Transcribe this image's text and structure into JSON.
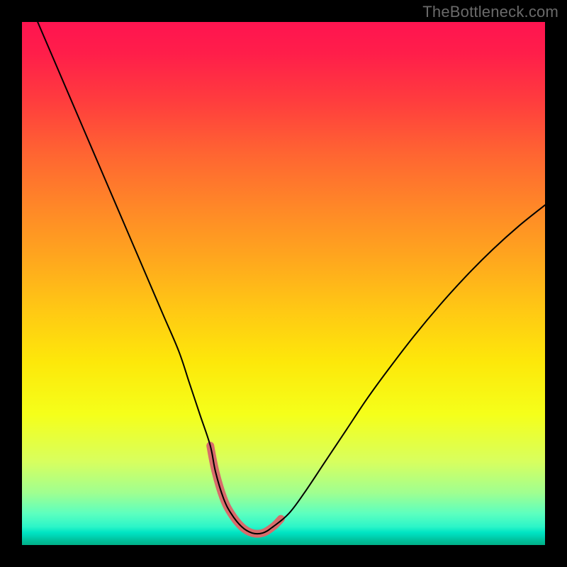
{
  "watermark": "TheBottleneck.com",
  "chart_data": {
    "type": "line",
    "title": "",
    "xlabel": "",
    "ylabel": "",
    "xlim": [
      0,
      100
    ],
    "ylim": [
      0,
      100
    ],
    "grid": false,
    "legend": false,
    "background_gradient": {
      "direction": "vertical",
      "stops": [
        {
          "pos": 0.0,
          "color": "#ff1450"
        },
        {
          "pos": 0.5,
          "color": "#ffc814"
        },
        {
          "pos": 0.75,
          "color": "#f5ff1a"
        },
        {
          "pos": 0.96,
          "color": "#2cf5c8"
        },
        {
          "pos": 1.0,
          "color": "#00b088"
        }
      ]
    },
    "series": [
      {
        "name": "bottleneck-curve",
        "stroke": "#000000",
        "stroke_width": 2,
        "x": [
          3,
          6,
          9,
          12,
          15,
          18,
          21,
          24,
          27,
          30,
          32,
          34,
          36,
          37,
          38.5,
          40,
          42,
          44,
          46,
          48,
          51,
          54,
          58,
          62,
          66,
          70,
          75,
          80,
          85,
          90,
          95,
          100
        ],
        "y": [
          100,
          93,
          86,
          79,
          72,
          65,
          58,
          51,
          44,
          37,
          31,
          25,
          19,
          14,
          9,
          6,
          3.5,
          2.3,
          2.3,
          3.5,
          6,
          10,
          16,
          22,
          28,
          33.5,
          40,
          46,
          51.5,
          56.5,
          61,
          65
        ]
      },
      {
        "name": "valley-highlight",
        "stroke": "#d86b6b",
        "stroke_width": 11,
        "linecap": "round",
        "x": [
          36,
          37,
          38.5,
          40,
          42,
          44,
          46,
          48,
          49.5
        ],
        "y": [
          19,
          14,
          9,
          6,
          3.5,
          2.3,
          2.3,
          3.5,
          5
        ]
      }
    ]
  }
}
